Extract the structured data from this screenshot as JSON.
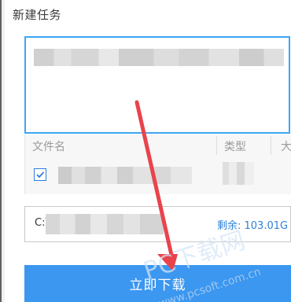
{
  "dialog": {
    "title": "新建任务"
  },
  "file_list": {
    "columns": [
      "文件名",
      "类型",
      "大"
    ],
    "item": {
      "checked": true
    }
  },
  "save_path": {
    "prefix": "C:\\",
    "remaining_space": "剩余: 103.01G"
  },
  "actions": {
    "download_label": "立即下载"
  },
  "watermark": {
    "text": "PC下载网",
    "url": "www.pcsoft.com.cn"
  },
  "colors": {
    "accent": "#3b97ef",
    "url_border": "#3ea6f3",
    "checkbox": "#2c7dde",
    "remaining_text": "#2f82d8",
    "annotation_arrow": "#e9434c"
  }
}
